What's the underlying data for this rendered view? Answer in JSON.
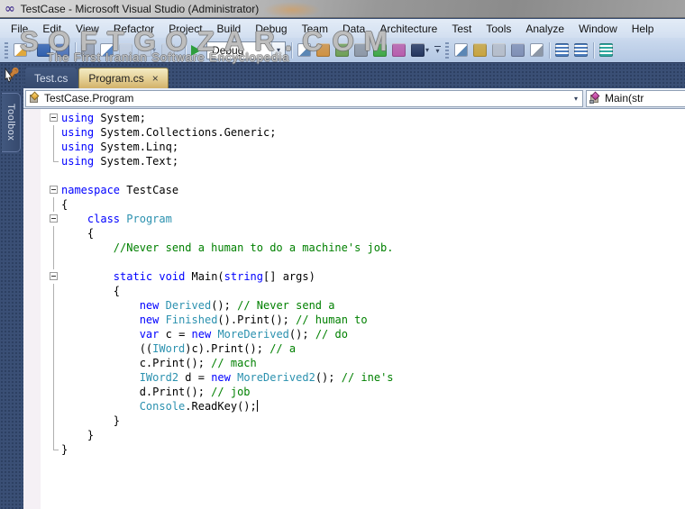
{
  "window": {
    "title": "TestCase - Microsoft Visual Studio (Administrator)",
    "icon": "visual-studio-infinity-icon",
    "icon_glyph": "∞"
  },
  "watermark": {
    "title": "SOFTGOZAR.COM",
    "subtitle": "The First Iranian Software Encyclopedia"
  },
  "menu": {
    "items": [
      "File",
      "Edit",
      "View",
      "Refactor",
      "Project",
      "Build",
      "Debug",
      "Team",
      "Data",
      "Architecture",
      "Test",
      "Tools",
      "Analyze",
      "Window",
      "Help"
    ]
  },
  "toolbar": {
    "standard_icons": [
      {
        "name": "new-project-icon",
        "shape": "doc",
        "color": "#e0a83c",
        "dropdown": true
      },
      {
        "name": "save-icon",
        "shape": "blob",
        "color": "#2f5fae"
      },
      {
        "name": "save-all-icon",
        "shape": "blob",
        "color": "#4f74b8"
      },
      {
        "sep": true
      },
      {
        "name": "cut-icon",
        "shape": "blob",
        "color": "#97a2b4"
      },
      {
        "name": "copy-icon",
        "shape": "doc",
        "color": "#5b87c5"
      },
      {
        "name": "paste-icon",
        "shape": "blob",
        "color": "#c3c9d4",
        "disabled": true
      },
      {
        "name": "undo-icon",
        "shape": "blob",
        "color": "#c3c9d4",
        "disabled": true,
        "dropdown": true
      },
      {
        "name": "redo-icon",
        "shape": "blob",
        "color": "#c3c9d4",
        "disabled": true,
        "dropdown": true
      }
    ],
    "start_debugging_label": "start-debugging",
    "debug_configuration": {
      "value": "Debug"
    },
    "secondary_icons": [
      {
        "name": "find-in-files-icon",
        "shape": "doc",
        "color": "#5b87b5"
      },
      {
        "name": "properties-window-icon",
        "shape": "blob",
        "color": "#d09140"
      },
      {
        "name": "object-browser-icon",
        "shape": "blob",
        "color": "#6fa055"
      },
      {
        "name": "tools-options-icon",
        "shape": "blob",
        "color": "#8d97a6"
      },
      {
        "name": "navigate-to-icon",
        "shape": "blob",
        "color": "#3fa846"
      },
      {
        "name": "extension-manager-icon",
        "shape": "blob",
        "color": "#b85cac"
      },
      {
        "name": "command-window-icon",
        "shape": "blob",
        "color": "#23355e",
        "dropdown": true
      }
    ],
    "text_editor_icons": [
      {
        "name": "display-member-list-icon",
        "shape": "doc",
        "color": "#5b87b5"
      },
      {
        "name": "display-parameter-info-icon",
        "shape": "blob",
        "color": "#c9a43c"
      },
      {
        "name": "display-quick-info-icon",
        "shape": "blob",
        "color": "#b5bdca"
      },
      {
        "name": "display-word-completion-icon",
        "shape": "blob",
        "color": "#7f8fb5"
      },
      {
        "name": "insert-snippet-icon",
        "shape": "doc",
        "color": "#8d97a6"
      },
      {
        "sep": true
      },
      {
        "name": "decrease-indent-icon",
        "shape": "lines",
        "color": "#4d7dbd"
      },
      {
        "name": "increase-indent-icon",
        "shape": "lines",
        "color": "#4d7dbd"
      },
      {
        "sep": true
      },
      {
        "name": "comment-selection-icon",
        "shape": "lines",
        "color": "#2fa8a0"
      }
    ]
  },
  "dock": {
    "toolbox_label": "Toolbox"
  },
  "tabs": {
    "items": [
      {
        "label": "Test.cs",
        "active": false,
        "closable": false
      },
      {
        "label": "Program.cs",
        "active": true,
        "closable": true,
        "close_glyph": "×"
      }
    ]
  },
  "navbar": {
    "types_value": "TestCase.Program",
    "members_value": "Main(str"
  },
  "colors": {
    "kw": "#0000ff",
    "ty": "#2b91af",
    "cm": "#008000",
    "pl": "#000000",
    "shell_bg": "#364a6e",
    "active_tab": "#dcc27e",
    "editor_bg": "#ffffff",
    "selection_margin": "#f5f0f5"
  },
  "editor": {
    "lines": [
      {
        "fold": "minus",
        "tokens": [
          [
            "kw",
            "using"
          ],
          [
            "pl",
            " System;"
          ]
        ]
      },
      {
        "fold": "line",
        "tokens": [
          [
            "kw",
            "using"
          ],
          [
            "pl",
            " System.Collections.Generic;"
          ]
        ]
      },
      {
        "fold": "line",
        "tokens": [
          [
            "kw",
            "using"
          ],
          [
            "pl",
            " System.Linq;"
          ]
        ]
      },
      {
        "fold": "end",
        "tokens": [
          [
            "kw",
            "using"
          ],
          [
            "pl",
            " System.Text;"
          ]
        ]
      },
      {
        "fold": "",
        "tokens": []
      },
      {
        "fold": "minus",
        "tokens": [
          [
            "kw",
            "namespace"
          ],
          [
            "pl",
            " TestCase"
          ]
        ]
      },
      {
        "fold": "line",
        "tokens": [
          [
            "pl",
            "{"
          ]
        ]
      },
      {
        "fold": "minus",
        "tokens": [
          [
            "pl",
            "    "
          ],
          [
            "kw",
            "class"
          ],
          [
            "pl",
            " "
          ],
          [
            "ty",
            "Program"
          ]
        ]
      },
      {
        "fold": "line",
        "tokens": [
          [
            "pl",
            "    {"
          ]
        ]
      },
      {
        "fold": "line",
        "tokens": [
          [
            "pl",
            "        "
          ],
          [
            "cm",
            "//Never send a human to do a machine's job."
          ]
        ]
      },
      {
        "fold": "line",
        "tokens": []
      },
      {
        "fold": "minus",
        "tokens": [
          [
            "pl",
            "        "
          ],
          [
            "kw",
            "static"
          ],
          [
            "pl",
            " "
          ],
          [
            "kw",
            "void"
          ],
          [
            "pl",
            " Main("
          ],
          [
            "kw",
            "string"
          ],
          [
            "pl",
            "[] args)"
          ]
        ]
      },
      {
        "fold": "line",
        "tokens": [
          [
            "pl",
            "        {"
          ]
        ]
      },
      {
        "fold": "line",
        "tokens": [
          [
            "pl",
            "            "
          ],
          [
            "kw",
            "new"
          ],
          [
            "pl",
            " "
          ],
          [
            "ty",
            "Derived"
          ],
          [
            "pl",
            "(); "
          ],
          [
            "cm",
            "// Never send a"
          ]
        ]
      },
      {
        "fold": "line",
        "tokens": [
          [
            "pl",
            "            "
          ],
          [
            "kw",
            "new"
          ],
          [
            "pl",
            " "
          ],
          [
            "ty",
            "Finished"
          ],
          [
            "pl",
            "().Print(); "
          ],
          [
            "cm",
            "// human to"
          ]
        ]
      },
      {
        "fold": "line",
        "tokens": [
          [
            "pl",
            "            "
          ],
          [
            "kw",
            "var"
          ],
          [
            "pl",
            " c = "
          ],
          [
            "kw",
            "new"
          ],
          [
            "pl",
            " "
          ],
          [
            "ty",
            "MoreDerived"
          ],
          [
            "pl",
            "(); "
          ],
          [
            "cm",
            "// do"
          ]
        ]
      },
      {
        "fold": "line",
        "tokens": [
          [
            "pl",
            "            (("
          ],
          [
            "ty",
            "IWord"
          ],
          [
            "pl",
            ")c).Print(); "
          ],
          [
            "cm",
            "// a"
          ]
        ]
      },
      {
        "fold": "line",
        "tokens": [
          [
            "pl",
            "            c.Print(); "
          ],
          [
            "cm",
            "// mach"
          ]
        ]
      },
      {
        "fold": "line",
        "tokens": [
          [
            "pl",
            "            "
          ],
          [
            "ty",
            "IWord2"
          ],
          [
            "pl",
            " d = "
          ],
          [
            "kw",
            "new"
          ],
          [
            "pl",
            " "
          ],
          [
            "ty",
            "MoreDerived2"
          ],
          [
            "pl",
            "(); "
          ],
          [
            "cm",
            "// ine's"
          ]
        ]
      },
      {
        "fold": "line",
        "tokens": [
          [
            "pl",
            "            d.Print(); "
          ],
          [
            "cm",
            "// job"
          ]
        ]
      },
      {
        "fold": "line",
        "caret": true,
        "tokens": [
          [
            "pl",
            "            "
          ],
          [
            "ty",
            "Console"
          ],
          [
            "pl",
            ".ReadKey();"
          ]
        ]
      },
      {
        "fold": "line",
        "tokens": [
          [
            "pl",
            "        }"
          ]
        ]
      },
      {
        "fold": "line",
        "tokens": [
          [
            "pl",
            "    }"
          ]
        ]
      },
      {
        "fold": "end",
        "tokens": [
          [
            "pl",
            "}"
          ]
        ]
      }
    ]
  }
}
